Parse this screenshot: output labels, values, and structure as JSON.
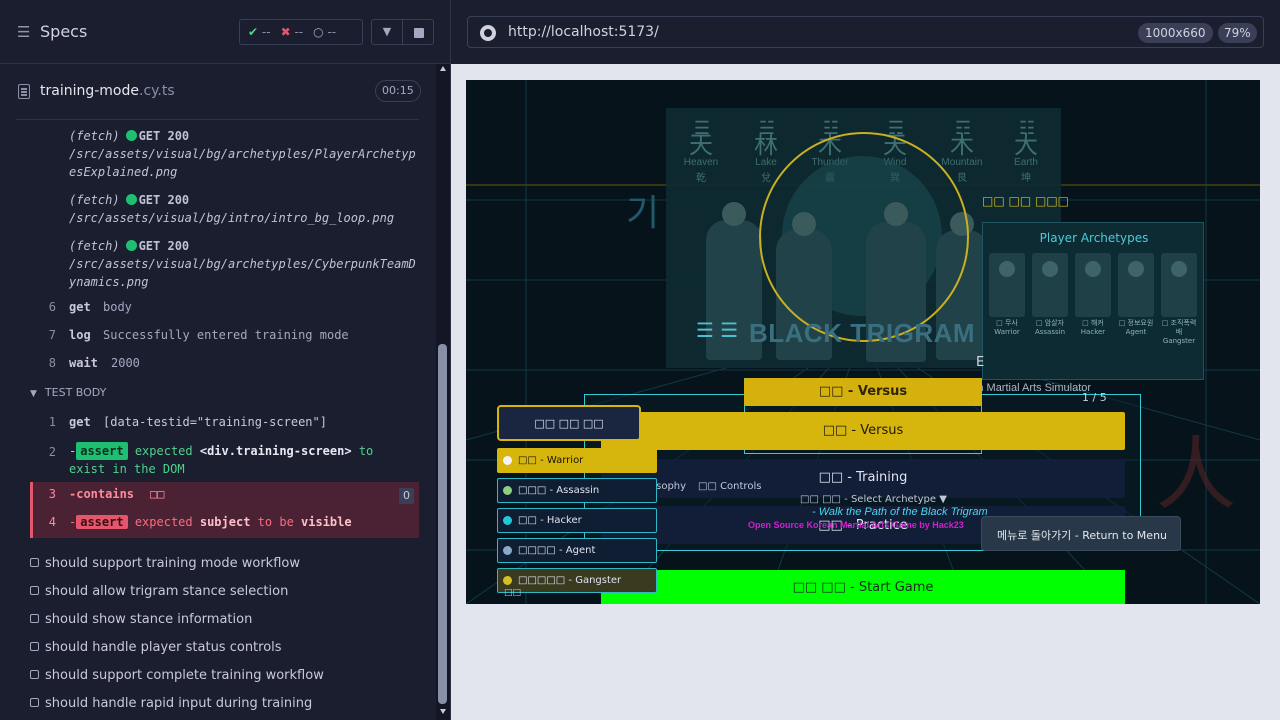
{
  "reporter": {
    "header": {
      "title": "Specs",
      "passed": "--",
      "failed": "--",
      "pending": "--"
    },
    "spec": {
      "name": "training-mode",
      "ext": ".cy.ts",
      "duration": "00:15"
    },
    "fetch_logs": [
      {
        "prefix": "(fetch)",
        "method": "GET 200",
        "url": "/src/assets/visual/bg/archetyples/PlayerArchetypesExplained.png"
      },
      {
        "prefix": "(fetch)",
        "method": "GET 200",
        "url": "/src/assets/visual/bg/intro/intro_bg_loop.png"
      },
      {
        "prefix": "(fetch)",
        "method": "GET 200",
        "url": "/src/assets/visual/bg/archetyples/CyberpunkTeamDynamics.png"
      }
    ],
    "before_commands": [
      {
        "num": "6",
        "name": "get",
        "arg": "body"
      },
      {
        "num": "7",
        "name": "log",
        "arg": "Successfully entered training mode"
      },
      {
        "num": "8",
        "name": "wait",
        "arg": "2000"
      }
    ],
    "test_body_label": "TEST BODY",
    "body_commands": [
      {
        "num": "1",
        "name": "get",
        "arg": "[data-testid=\"training-screen\"]"
      },
      {
        "num": "2",
        "prefix": "-",
        "badge": "assert",
        "text1": "expected",
        "target": "<div.training-screen>",
        "text2": "to",
        "text3": "exist in the DOM"
      },
      {
        "num": "3",
        "prefix": "-",
        "name": "contains",
        "arg": "□□",
        "count": "0"
      },
      {
        "num": "4",
        "prefix": "-",
        "badge": "assert",
        "text1": "expected",
        "target": "subject",
        "text2": "to be",
        "text3": "visible"
      }
    ],
    "tests": [
      "should support training mode workflow",
      "should allow trigram stance selection",
      "should show stance information",
      "should handle player status controls",
      "should support complete training workflow",
      "should handle rapid input during training"
    ]
  },
  "browser": {
    "url": "http://localhost:5173/",
    "viewport": "1000x660",
    "zoom": "79%"
  },
  "game": {
    "trigrams": [
      {
        "bars": "☰",
        "glyph": "天",
        "label": "Heaven",
        "sub": "乾"
      },
      {
        "bars": "☱",
        "glyph": "林",
        "label": "Lake",
        "sub": "兌"
      },
      {
        "bars": "☳",
        "glyph": "木",
        "label": "Thunder",
        "sub": "震"
      },
      {
        "bars": "☴",
        "glyph": "天",
        "label": "Wind",
        "sub": "巽"
      },
      {
        "bars": "☶",
        "glyph": "木",
        "label": "Mountain",
        "sub": "艮"
      },
      {
        "bars": "☷",
        "glyph": "大",
        "label": "Earth",
        "sub": "坤"
      }
    ],
    "title": "BLACK TRIGRAM",
    "side_glyph": "기",
    "right_glyph": "人",
    "korean_caption": "□□ □□ □□□",
    "archetypes_title": "Player Archetypes",
    "archetype_cards": [
      {
        "name": "□ 무사",
        "desc": "Warrior"
      },
      {
        "name": "□ 암살자",
        "desc": "Assassin"
      },
      {
        "name": "□ 해커",
        "desc": "Hacker"
      },
      {
        "name": "□ 정보요원",
        "desc": "Agent"
      },
      {
        "name": "□ 조직폭력배",
        "desc": "Gangster"
      }
    ],
    "subtitle": "Korean Martial Arts Simulator",
    "e_letter": "E",
    "page_count": "1 / 5",
    "menu": {
      "versus_ghost": "□□ - Versus",
      "versus": "□□ - Versus",
      "training": "□□ - Training",
      "practice": "□□ - Practice",
      "start": "□□ □□ - Start Game",
      "philosophy": "□□ Philosophy",
      "controls": "□□ Controls",
      "select_archetype": "□□ □□ - Select Archetype ▼",
      "walk_path": "- Walk the Path of the Black Trigram",
      "open_source": "Open Source Korean Martial Arts Game by Hack23",
      "return": "메뉴로 돌아가기 - Return to Menu"
    },
    "selector": {
      "label": "□□ □□ □□",
      "options": [
        {
          "label": "□□ - Warrior",
          "color": "#f4f4f4",
          "active": true
        },
        {
          "label": "□□□ - Assassin",
          "color": "#8ccf7e",
          "active": false
        },
        {
          "label": "□□ - Hacker",
          "color": "#20c8d8",
          "active": false
        },
        {
          "label": "□□□□ - Agent",
          "color": "#8aa8c8",
          "active": false
        },
        {
          "label": "□□□□□ - Gangster",
          "color": "#d6c020",
          "active": false
        }
      ]
    },
    "bottom_left_text": "□□"
  }
}
